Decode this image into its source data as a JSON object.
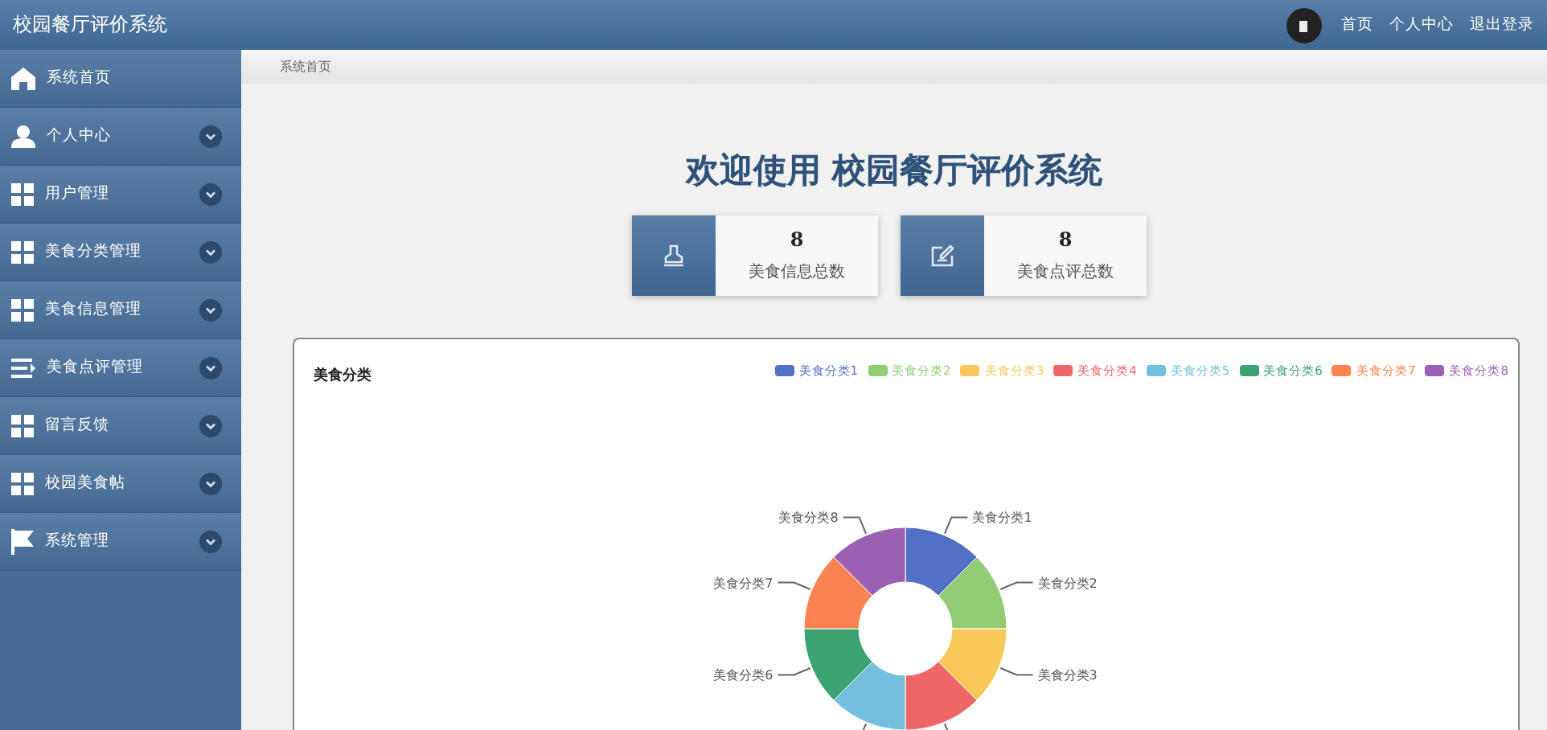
{
  "header": {
    "title": "校园餐厅评价系统",
    "links": [
      "首页",
      "个人中心",
      "退出登录"
    ]
  },
  "sidebar": {
    "items": [
      {
        "label": "系统首页",
        "kind": "home",
        "expandable": false
      },
      {
        "label": "个人中心",
        "kind": "user",
        "expandable": true
      },
      {
        "label": "用户管理",
        "kind": "grid",
        "expandable": true
      },
      {
        "label": "美食分类管理",
        "kind": "grid",
        "expandable": true
      },
      {
        "label": "美食信息管理",
        "kind": "grid",
        "expandable": true
      },
      {
        "label": "美食点评管理",
        "kind": "list",
        "expandable": true
      },
      {
        "label": "留言反馈",
        "kind": "grid",
        "expandable": true
      },
      {
        "label": "校园美食帖",
        "kind": "grid",
        "expandable": true
      },
      {
        "label": "系统管理",
        "kind": "flag",
        "expandable": true
      }
    ]
  },
  "breadcrumb": "系统首页",
  "welcome": "欢迎使用 校园餐厅评价系统",
  "stats": [
    {
      "kind": "stamp",
      "value": "8",
      "label": "美食信息总数"
    },
    {
      "kind": "edit",
      "value": "8",
      "label": "美食点评总数"
    }
  ],
  "chart_panel": {
    "title": "美食分类",
    "chart_data": {
      "type": "donut",
      "categories": [
        "美食分类1",
        "美食分类2",
        "美食分类3",
        "美食分类4",
        "美食分类5",
        "美食分类6",
        "美食分类7",
        "美食分类8"
      ],
      "values": [
        1,
        1,
        1,
        1,
        1,
        1,
        1,
        1
      ],
      "colors": [
        "#5470c6",
        "#91cc75",
        "#fac858",
        "#ee6666",
        "#73c0de",
        "#3ba272",
        "#fc8452",
        "#9a60b4"
      ]
    }
  }
}
